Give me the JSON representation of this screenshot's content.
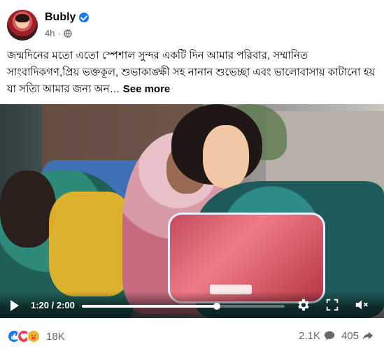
{
  "post": {
    "author": "Bubly",
    "verified": true,
    "time": "4h",
    "privacy_icon": "globe-icon",
    "caption": "জন্মদিনের মতো এতো স্পেশাল সুন্দর একটি দিন আমার পরিবার, সম্মানিত সাংবাদিকগণ,প্রিয় ভক্তকূল, শুভাকাঙ্ক্ষী সহ নানান শুভেচ্ছা এবং ভালোবাসায় কাটানো হয় যা সত্যি আমার জন্য অন…",
    "see_more": "See more"
  },
  "video": {
    "current_time": "1:20",
    "duration": "2:00",
    "time_display": "1:20 / 2:00",
    "progress": 0.6667
  },
  "footer": {
    "reactions_count": "18K",
    "comments_count": "2.1K",
    "shares_count": "405",
    "colors": {
      "like": "#1877f2",
      "love": "#f33e58",
      "care": "#f7b125"
    }
  }
}
